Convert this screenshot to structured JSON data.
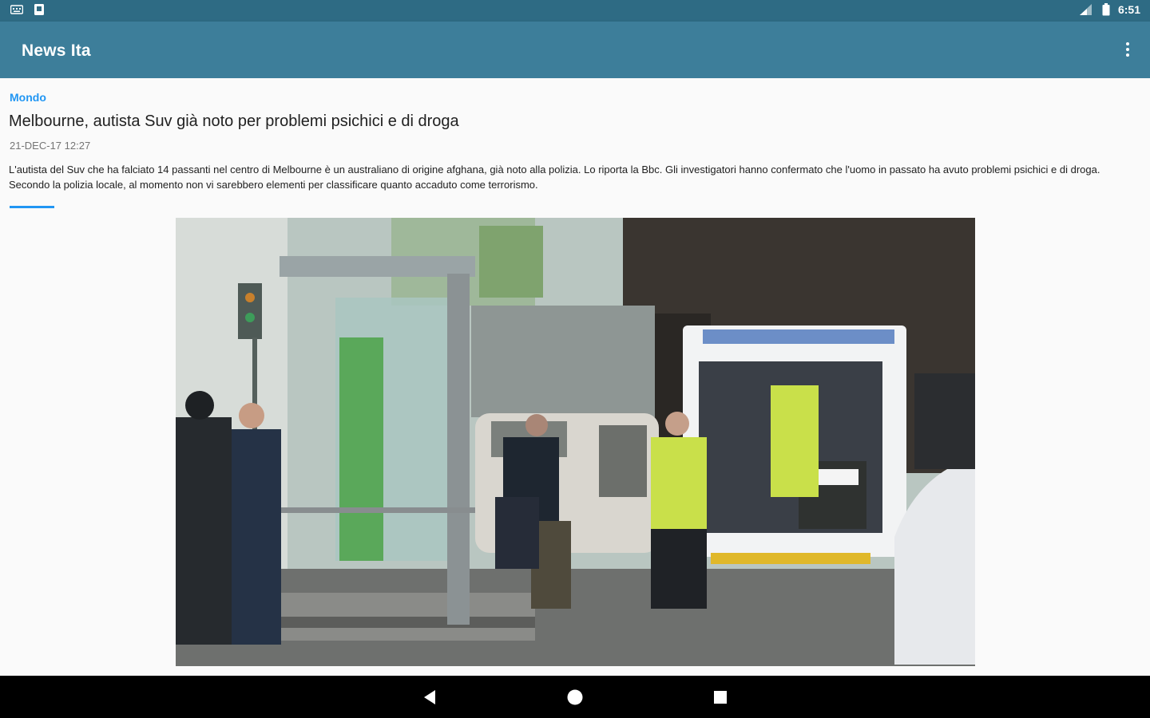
{
  "status_bar": {
    "time": "6:51",
    "icons": [
      "keyboard-icon",
      "notification-icon",
      "signal-icon",
      "battery-icon"
    ]
  },
  "app_bar": {
    "title": "News Ita",
    "menu_icon": "overflow-menu-icon"
  },
  "article": {
    "category": "Mondo",
    "title": "Melbourne, autista Suv già noto per problemi psichici e di droga",
    "date": "21-DEC-17 12:27",
    "summary": "L'autista del Suv che ha falciato 14 passanti nel centro di Melbourne è un australiano di origine afghana, già noto alla polizia. Lo riporta la Bbc. Gli investigatori hanno confermato che l'uomo in passato ha avuto problemi psichici e di droga. Secondo la polizia locale, al momento non vi sarebbero elementi per classificare quanto accaduto come terrorismo."
  },
  "nav_bar": {
    "buttons": [
      "back-icon",
      "home-icon",
      "recents-icon"
    ]
  },
  "colors": {
    "status_bar": "#2e6b84",
    "app_bar": "#3d7e9a",
    "accent": "#2196f3",
    "background": "#fafafa"
  }
}
